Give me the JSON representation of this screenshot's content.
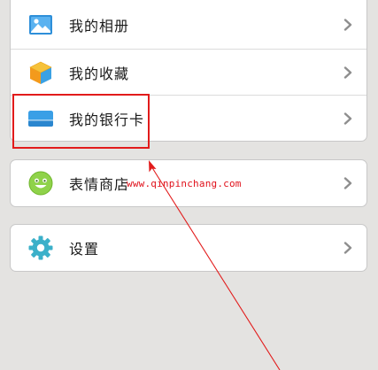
{
  "menu": {
    "group1": {
      "items": [
        {
          "label": "我的相册",
          "icon": "photo-album-icon"
        },
        {
          "label": "我的收藏",
          "icon": "favorites-cube-icon"
        },
        {
          "label": "我的银行卡",
          "icon": "bank-card-icon"
        }
      ]
    },
    "group2": {
      "items": [
        {
          "label": "表情商店",
          "icon": "smiley-face-icon"
        }
      ]
    },
    "group3": {
      "items": [
        {
          "label": "设置",
          "icon": "gear-icon"
        }
      ]
    }
  },
  "annotation": {
    "watermark": "www.qinpinchang.com",
    "highlight_color": "#e21b1b"
  },
  "colors": {
    "background": "#e4e3e1",
    "card": "#ffffff",
    "text": "#1a1a1a",
    "chevron": "#8e8e8e"
  }
}
